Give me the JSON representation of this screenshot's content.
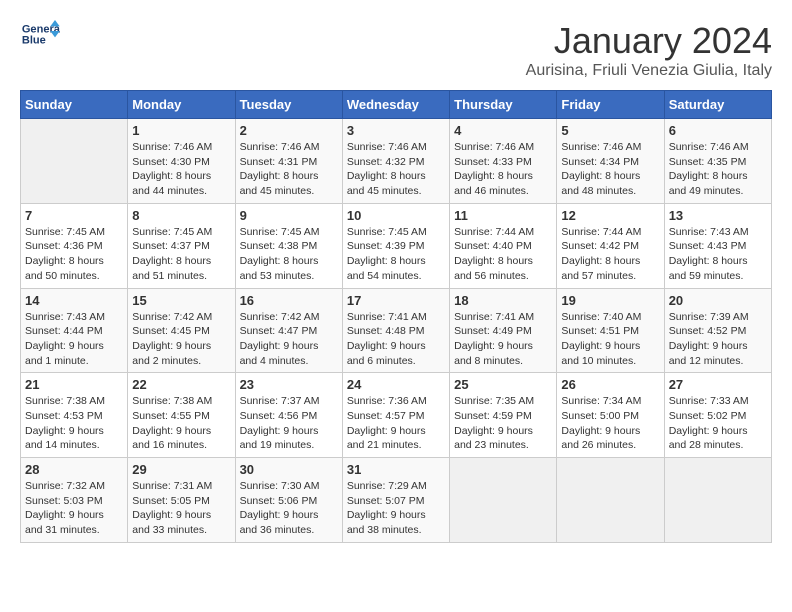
{
  "header": {
    "logo_line1": "General",
    "logo_line2": "Blue",
    "title": "January 2024",
    "subtitle": "Aurisina, Friuli Venezia Giulia, Italy"
  },
  "calendar": {
    "days_of_week": [
      "Sunday",
      "Monday",
      "Tuesday",
      "Wednesday",
      "Thursday",
      "Friday",
      "Saturday"
    ],
    "weeks": [
      [
        {
          "day": "",
          "empty": true
        },
        {
          "day": "1",
          "sunrise": "7:46 AM",
          "sunset": "4:30 PM",
          "daylight": "8 hours and 44 minutes."
        },
        {
          "day": "2",
          "sunrise": "7:46 AM",
          "sunset": "4:31 PM",
          "daylight": "8 hours and 45 minutes."
        },
        {
          "day": "3",
          "sunrise": "7:46 AM",
          "sunset": "4:32 PM",
          "daylight": "8 hours and 45 minutes."
        },
        {
          "day": "4",
          "sunrise": "7:46 AM",
          "sunset": "4:33 PM",
          "daylight": "8 hours and 46 minutes."
        },
        {
          "day": "5",
          "sunrise": "7:46 AM",
          "sunset": "4:34 PM",
          "daylight": "8 hours and 48 minutes."
        },
        {
          "day": "6",
          "sunrise": "7:46 AM",
          "sunset": "4:35 PM",
          "daylight": "8 hours and 49 minutes."
        }
      ],
      [
        {
          "day": "7",
          "sunrise": "7:45 AM",
          "sunset": "4:36 PM",
          "daylight": "8 hours and 50 minutes."
        },
        {
          "day": "8",
          "sunrise": "7:45 AM",
          "sunset": "4:37 PM",
          "daylight": "8 hours and 51 minutes."
        },
        {
          "day": "9",
          "sunrise": "7:45 AM",
          "sunset": "4:38 PM",
          "daylight": "8 hours and 53 minutes."
        },
        {
          "day": "10",
          "sunrise": "7:45 AM",
          "sunset": "4:39 PM",
          "daylight": "8 hours and 54 minutes."
        },
        {
          "day": "11",
          "sunrise": "7:44 AM",
          "sunset": "4:40 PM",
          "daylight": "8 hours and 56 minutes."
        },
        {
          "day": "12",
          "sunrise": "7:44 AM",
          "sunset": "4:42 PM",
          "daylight": "8 hours and 57 minutes."
        },
        {
          "day": "13",
          "sunrise": "7:43 AM",
          "sunset": "4:43 PM",
          "daylight": "8 hours and 59 minutes."
        }
      ],
      [
        {
          "day": "14",
          "sunrise": "7:43 AM",
          "sunset": "4:44 PM",
          "daylight": "9 hours and 1 minute."
        },
        {
          "day": "15",
          "sunrise": "7:42 AM",
          "sunset": "4:45 PM",
          "daylight": "9 hours and 2 minutes."
        },
        {
          "day": "16",
          "sunrise": "7:42 AM",
          "sunset": "4:47 PM",
          "daylight": "9 hours and 4 minutes."
        },
        {
          "day": "17",
          "sunrise": "7:41 AM",
          "sunset": "4:48 PM",
          "daylight": "9 hours and 6 minutes."
        },
        {
          "day": "18",
          "sunrise": "7:41 AM",
          "sunset": "4:49 PM",
          "daylight": "9 hours and 8 minutes."
        },
        {
          "day": "19",
          "sunrise": "7:40 AM",
          "sunset": "4:51 PM",
          "daylight": "9 hours and 10 minutes."
        },
        {
          "day": "20",
          "sunrise": "7:39 AM",
          "sunset": "4:52 PM",
          "daylight": "9 hours and 12 minutes."
        }
      ],
      [
        {
          "day": "21",
          "sunrise": "7:38 AM",
          "sunset": "4:53 PM",
          "daylight": "9 hours and 14 minutes."
        },
        {
          "day": "22",
          "sunrise": "7:38 AM",
          "sunset": "4:55 PM",
          "daylight": "9 hours and 16 minutes."
        },
        {
          "day": "23",
          "sunrise": "7:37 AM",
          "sunset": "4:56 PM",
          "daylight": "9 hours and 19 minutes."
        },
        {
          "day": "24",
          "sunrise": "7:36 AM",
          "sunset": "4:57 PM",
          "daylight": "9 hours and 21 minutes."
        },
        {
          "day": "25",
          "sunrise": "7:35 AM",
          "sunset": "4:59 PM",
          "daylight": "9 hours and 23 minutes."
        },
        {
          "day": "26",
          "sunrise": "7:34 AM",
          "sunset": "5:00 PM",
          "daylight": "9 hours and 26 minutes."
        },
        {
          "day": "27",
          "sunrise": "7:33 AM",
          "sunset": "5:02 PM",
          "daylight": "9 hours and 28 minutes."
        }
      ],
      [
        {
          "day": "28",
          "sunrise": "7:32 AM",
          "sunset": "5:03 PM",
          "daylight": "9 hours and 31 minutes."
        },
        {
          "day": "29",
          "sunrise": "7:31 AM",
          "sunset": "5:05 PM",
          "daylight": "9 hours and 33 minutes."
        },
        {
          "day": "30",
          "sunrise": "7:30 AM",
          "sunset": "5:06 PM",
          "daylight": "9 hours and 36 minutes."
        },
        {
          "day": "31",
          "sunrise": "7:29 AM",
          "sunset": "5:07 PM",
          "daylight": "9 hours and 38 minutes."
        },
        {
          "day": "",
          "empty": true
        },
        {
          "day": "",
          "empty": true
        },
        {
          "day": "",
          "empty": true
        }
      ]
    ]
  }
}
